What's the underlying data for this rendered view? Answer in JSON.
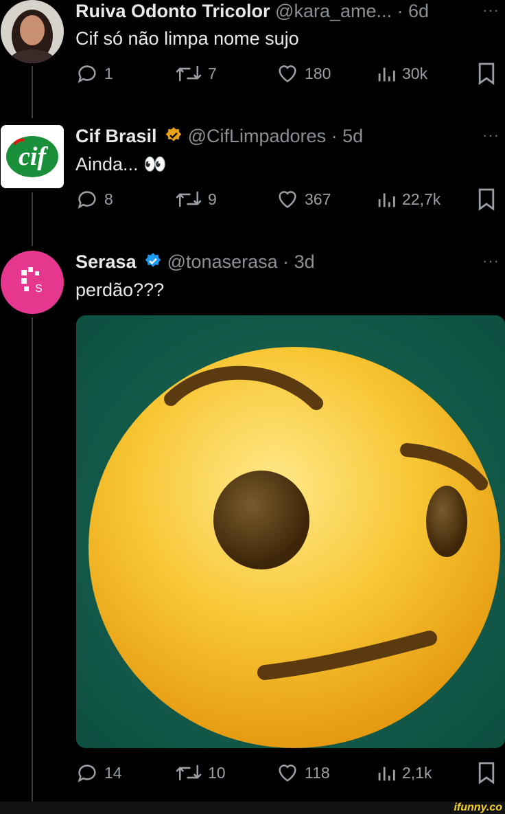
{
  "tweets": [
    {
      "name": "Ruiva Odonto Tricolor",
      "handle": "@kara_ame...",
      "time": "· 6d",
      "text": "Cif só não limpa nome sujo",
      "replies": "1",
      "retweets": "7",
      "likes": "180",
      "views": "30k",
      "avatar_icon": "profile-photo"
    },
    {
      "name": "Cif Brasil",
      "handle": "@CifLimpadores",
      "time": "· 5d",
      "text": "Ainda... 👀",
      "replies": "8",
      "retweets": "9",
      "likes": "367",
      "views": "22,7k",
      "avatar_logo": "cif",
      "verified_color": "#e8a317"
    },
    {
      "name": "Serasa",
      "handle": "@tonaserasa",
      "time": "· 3d",
      "text": "perdão???",
      "replies": "14",
      "retweets": "10",
      "likes": "118",
      "views": "2,1k",
      "avatar_logo": "S",
      "verified_color": "#1d9bf0",
      "media": "raised-eyebrow-emoji-image"
    }
  ],
  "more_label": "···",
  "watermark": "ifunny.co"
}
